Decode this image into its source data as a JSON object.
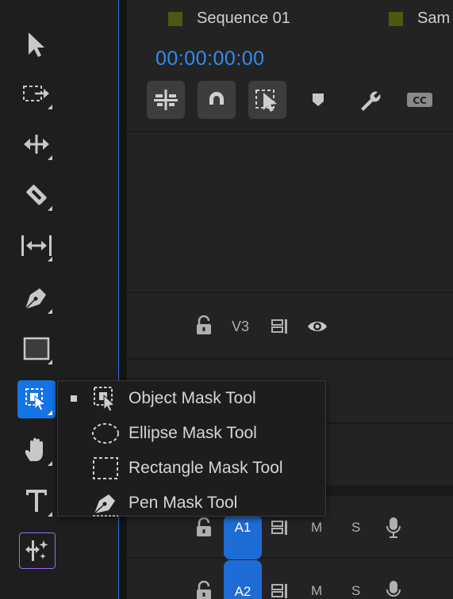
{
  "timeline": {
    "tabs": [
      {
        "label": "Sequence 01"
      },
      {
        "label": "Sam"
      }
    ],
    "timecode": "00:00:00:00",
    "tracks": {
      "v3": {
        "label": "V3"
      },
      "a1": {
        "label": "A1",
        "m": "M",
        "s": "S"
      },
      "a2": {
        "label": "A2",
        "m": "M",
        "s": "S"
      }
    },
    "colors": {
      "accent": "#2f8cf0",
      "selected_tool": "#1473e6",
      "tab_swatch": "#4a5a12"
    }
  },
  "toolbar": {
    "tools": [
      {
        "icon": "selection-arrow-icon"
      },
      {
        "icon": "track-select-forward-icon"
      },
      {
        "icon": "ripple-edit-icon"
      },
      {
        "icon": "razor-icon"
      },
      {
        "icon": "slip-icon"
      },
      {
        "icon": "pen-icon"
      },
      {
        "icon": "rectangle-icon"
      },
      {
        "icon": "object-mask-icon",
        "selected": true
      },
      {
        "icon": "hand-icon"
      },
      {
        "icon": "type-icon"
      },
      {
        "icon": "generative-extend-icon"
      }
    ]
  },
  "flyout": {
    "items": [
      {
        "label": "Object Mask Tool",
        "icon": "object-mask-icon",
        "selected": true
      },
      {
        "label": "Ellipse Mask Tool",
        "icon": "ellipse-mask-icon"
      },
      {
        "label": "Rectangle Mask Tool",
        "icon": "rectangle-mask-icon"
      },
      {
        "label": "Pen Mask Tool",
        "icon": "pen-mask-icon"
      }
    ]
  }
}
